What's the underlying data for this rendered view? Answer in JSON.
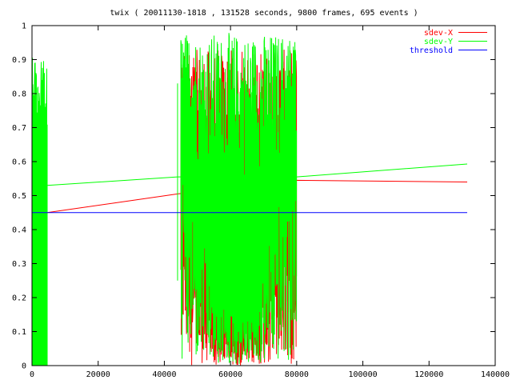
{
  "chart_data": {
    "type": "line",
    "title": "twix ( 20011130-1818 , 131528 seconds, 9800 frames, 695 events )",
    "xlabel": "",
    "ylabel": "",
    "xlim": [
      0,
      140000
    ],
    "ylim": [
      0,
      1
    ],
    "x_ticks": [
      0,
      20000,
      40000,
      60000,
      80000,
      100000,
      120000,
      140000
    ],
    "x_tick_labels": [
      "0",
      "20000",
      "40000",
      "60000",
      "80000",
      "100000",
      "120000",
      "140000"
    ],
    "y_ticks": [
      0,
      0.1,
      0.2,
      0.3,
      0.4,
      0.5,
      0.6,
      0.7,
      0.8,
      0.9,
      1
    ],
    "y_tick_labels": [
      "0",
      "0.1",
      "0.2",
      "0.3",
      "0.4",
      "0.5",
      "0.6",
      "0.7",
      "0.8",
      "0.9",
      "1"
    ],
    "legend_position": "top-right",
    "grid": false,
    "series": [
      {
        "name": "sdev-X",
        "color": "#ff0000",
        "style": "oscillating",
        "segments": [
          {
            "x0": 0,
            "x1": 4600,
            "lo": 0.0,
            "hi": 0.73
          },
          {
            "x0": 45000,
            "x1": 80000,
            "lo": 0.0,
            "hi": 0.93
          }
        ],
        "envelope": [
          [
            44000,
            0.5
          ],
          [
            46000,
            0.5
          ],
          [
            48000,
            0.42
          ],
          [
            50000,
            0.3
          ],
          [
            56000,
            0.12
          ],
          [
            62000,
            0.12
          ],
          [
            68000,
            0.12
          ],
          [
            72000,
            0.3
          ],
          [
            74000,
            0.38
          ],
          [
            78000,
            0.5
          ],
          [
            80000,
            0.55
          ]
        ],
        "trend": [
          [
            4600,
            0.45
          ],
          [
            44000,
            0.505
          ],
          [
            80000,
            0.545
          ],
          [
            131528,
            0.54
          ]
        ]
      },
      {
        "name": "sdev-Y",
        "color": "#00ff00",
        "style": "oscillating",
        "segments": [
          {
            "x0": 0,
            "x1": 4600,
            "lo": 0.0,
            "hi": 0.91
          },
          {
            "x0": 45000,
            "x1": 80000,
            "lo": 0.0,
            "hi": 0.98
          }
        ],
        "envelope": [
          [
            44000,
            0.58
          ],
          [
            46000,
            0.62
          ],
          [
            48000,
            0.6
          ],
          [
            50000,
            0.5
          ],
          [
            56000,
            0.2
          ],
          [
            62000,
            0.2
          ],
          [
            68000,
            0.2
          ],
          [
            72000,
            0.45
          ],
          [
            74000,
            0.5
          ],
          [
            78000,
            0.57
          ],
          [
            80000,
            0.6
          ]
        ],
        "spikes": [
          [
            44000,
            0.25,
            0.83
          ],
          [
            79500,
            0.19,
            0.6
          ]
        ],
        "trend": [
          [
            4600,
            0.53
          ],
          [
            44000,
            0.555
          ],
          [
            80000,
            0.555
          ],
          [
            131528,
            0.593
          ]
        ]
      },
      {
        "name": "threshold",
        "color": "#0000ff",
        "style": "line",
        "points": [
          [
            0,
            0.45
          ],
          [
            131528,
            0.45
          ]
        ]
      }
    ]
  }
}
